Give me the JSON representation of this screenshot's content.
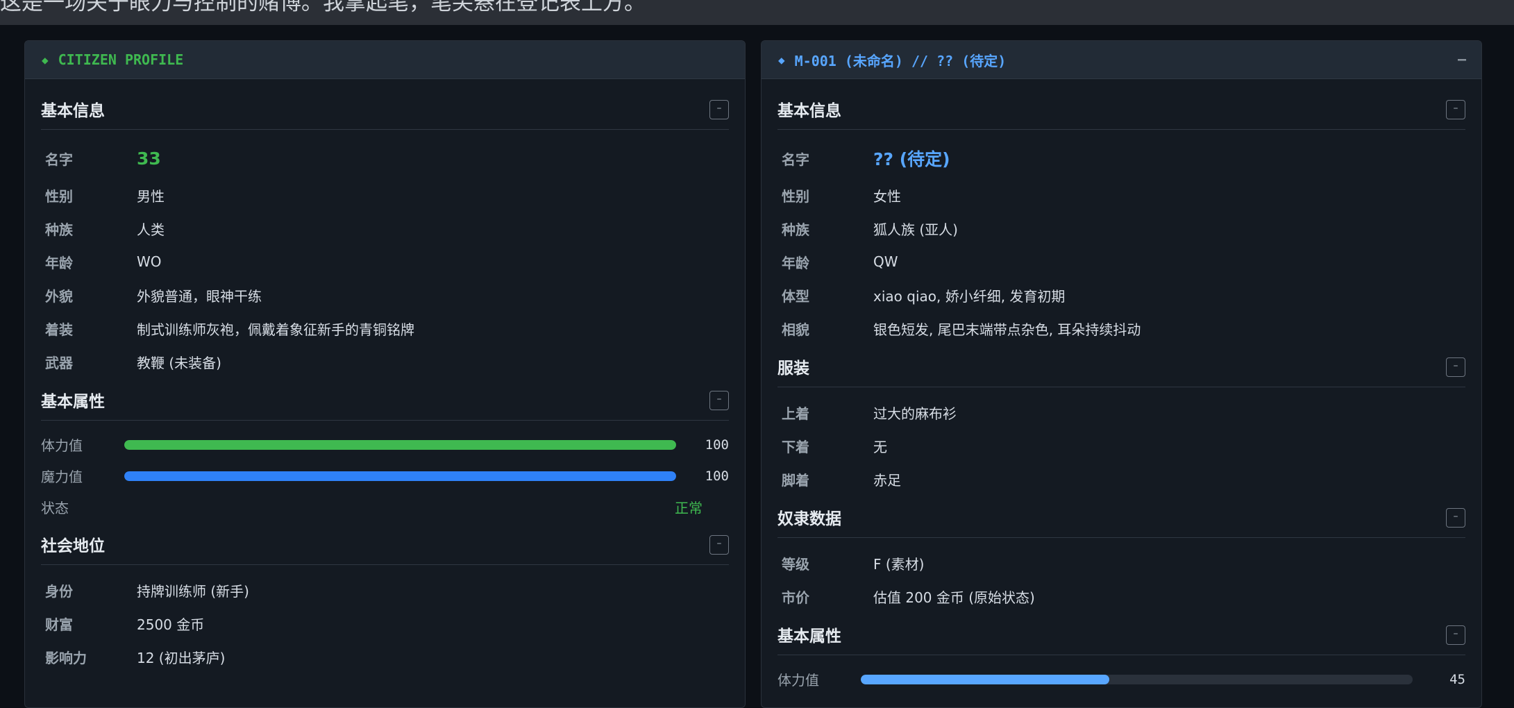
{
  "topbar": {
    "text": "这是一场关于眼力与控制的赌博。我拿起笔，笔尖悬在登记表上方。"
  },
  "left": {
    "header": {
      "icon": "diamond-icon",
      "title": "CITIZEN PROFILE"
    },
    "basic": {
      "title": "基本信息",
      "collapse": "–",
      "rows": [
        {
          "k": "名字",
          "v": "33"
        },
        {
          "k": "性别",
          "v": "男性"
        },
        {
          "k": "种族",
          "v": "人类"
        },
        {
          "k": "年龄",
          "v": "WO"
        },
        {
          "k": "外貌",
          "v": "外貌普通，眼神干练"
        },
        {
          "k": "着装",
          "v": "制式训练师灰袍，佩戴着象征新手的青铜铭牌"
        },
        {
          "k": "武器",
          "v": "教鞭 (未装备)"
        }
      ]
    },
    "attrs": {
      "title": "基本属性",
      "collapse": "–",
      "stats": [
        {
          "k": "体力值",
          "value": "100",
          "fraction": 1.0,
          "color": "#3fb950"
        },
        {
          "k": "魔力值",
          "value": "100",
          "fraction": 1.0,
          "color": "#2f81f7"
        }
      ],
      "status_label": "状态",
      "status_value": "正常"
    },
    "social": {
      "title": "社会地位",
      "collapse": "–",
      "rows": [
        {
          "k": "身份",
          "v": "持牌训练师 (新手)"
        },
        {
          "k": "财富",
          "v": "2500 金币"
        },
        {
          "k": "影响力",
          "v": "12 (初出茅庐)"
        }
      ]
    }
  },
  "right": {
    "header": {
      "icon": "diamond-icon",
      "title": "M-001 (未命名) // ?? (待定)",
      "collapse": "–"
    },
    "basic": {
      "title": "基本信息",
      "collapse": "–",
      "rows": [
        {
          "k": "名字",
          "v": "?? (待定)"
        },
        {
          "k": "性别",
          "v": "女性"
        },
        {
          "k": "种族",
          "v": "狐人族 (亚人)"
        },
        {
          "k": "年龄",
          "v": "QW"
        },
        {
          "k": "体型",
          "v": "xiao qiao, 娇小纤细, 发育初期"
        },
        {
          "k": "相貌",
          "v": "银色短发, 尾巴末端带点杂色, 耳朵持续抖动"
        }
      ]
    },
    "clothing": {
      "title": "服装",
      "collapse": "–",
      "rows": [
        {
          "k": "上着",
          "v": "过大的麻布衫"
        },
        {
          "k": "下着",
          "v": "无"
        },
        {
          "k": "脚着",
          "v": "赤足"
        }
      ]
    },
    "slave": {
      "title": "奴隶数据",
      "collapse": "–",
      "rows": [
        {
          "k": "等级",
          "v": "F (素材)"
        },
        {
          "k": "市价",
          "v": "估值 200 金币 (原始状态)"
        }
      ]
    },
    "attrs": {
      "title": "基本属性",
      "collapse": "–",
      "stats": [
        {
          "k": "体力值",
          "value": "45",
          "fraction": 0.45,
          "color": "#58a6ff"
        }
      ]
    }
  }
}
